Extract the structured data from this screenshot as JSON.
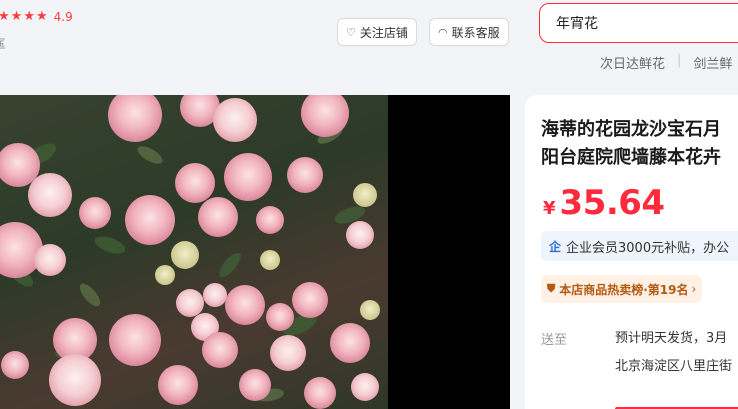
{
  "shop": {
    "rating": "4.9",
    "sub_label": "匤",
    "follow_label": "关注店铺",
    "contact_label": "联系客服",
    "follow_icon": "heart-icon",
    "contact_icon": "headset-icon"
  },
  "search": {
    "value": "年宵花",
    "hot_words": [
      "次日达鲜花",
      "剑兰鲜"
    ]
  },
  "product": {
    "title_line1": "海蒂的花园龙沙宝石月",
    "title_line2": "阳台庭院爬墙藤本花卉",
    "currency": "¥",
    "price": "35.64",
    "promo_text": "企业会员3000元补贴，办公",
    "rank_text": "本店商品热卖榜·第19名",
    "rank_chevron": "›",
    "ship_label": "送至",
    "ship_line1": "预计明天发货，3月",
    "ship_line2": "北京海淀区八里庄街"
  },
  "colors": {
    "accent": "#ff2b3d",
    "promo_icon": "#2a6fd6",
    "rank_text": "#b35a10"
  }
}
